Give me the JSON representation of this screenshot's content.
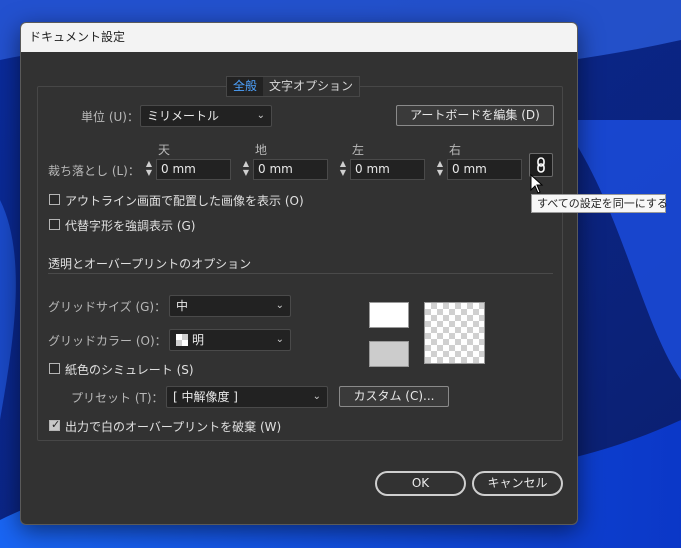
{
  "window": {
    "title": "ドキュメント設定"
  },
  "tabs": [
    {
      "label": "全般",
      "active": true
    },
    {
      "label": "文字オプション",
      "active": false
    }
  ],
  "units": {
    "label": "単位 (U)：",
    "value": "ミリメートル"
  },
  "artboard_button": "アートボードを編集 (D)",
  "bleed": {
    "label": "裁ち落とし (L)：",
    "fields": [
      {
        "name": "天",
        "value": "0 mm"
      },
      {
        "name": "地",
        "value": "0 mm"
      },
      {
        "name": "左",
        "value": "0 mm"
      },
      {
        "name": "右",
        "value": "0 mm"
      }
    ],
    "link_tooltip": "すべての設定を同一にする"
  },
  "checkboxes": {
    "outline_images": {
      "label": "アウトライン画面で配置した画像を表示 (O)",
      "checked": false
    },
    "highlight_glyphs": {
      "label": "代替字形を強調表示 (G)",
      "checked": false
    }
  },
  "transparency": {
    "section_title": "透明とオーバープリントのオプション",
    "grid_size": {
      "label": "グリッドサイズ (G)：",
      "value": "中"
    },
    "grid_color": {
      "label": "グリッドカラー (O)：",
      "value": "明"
    },
    "simulate_paper": {
      "label": "紙色のシミュレート (S)",
      "checked": false
    },
    "preset": {
      "label": "プリセット (T)：",
      "value": "[ 中解像度 ]"
    },
    "custom_button": "カスタム (C)...",
    "discard_overprint": {
      "label": "出力で白のオーバープリントを破棄 (W)",
      "checked": true
    }
  },
  "footer": {
    "ok": "OK",
    "cancel": "キャンセル"
  },
  "colors": {
    "accent": "#4ea3ff",
    "dialog_bg": "#323232",
    "swatch_top": "#ffffff",
    "swatch_bottom": "#cccccc"
  }
}
